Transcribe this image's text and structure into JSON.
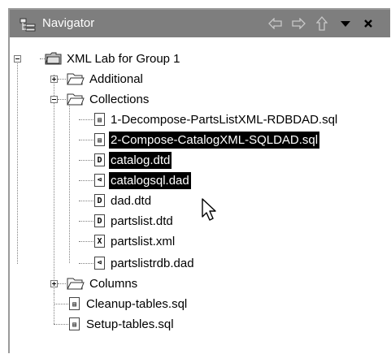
{
  "navigator": {
    "title": "Navigator",
    "icons": [
      "navigator-view-icon",
      "back-arrow-icon",
      "forward-arrow-icon",
      "up-arrow-icon",
      "view-menu-icon",
      "close-icon"
    ]
  },
  "tree": {
    "root": "XML Lab for Group 1",
    "additional": "Additional",
    "collections": "Collections",
    "file1": "1-Decompose-PartsListXML-RDBDAD.sql",
    "file2": "2-Compose-CatalogXML-SQLDAD.sql",
    "file3": "catalog.dtd",
    "file4": "catalogsql.dad",
    "file5": "dad.dtd",
    "file6": "partslist.dtd",
    "file7": "partslist.xml",
    "file8": "partslistrdb.dad",
    "columns": "Columns",
    "file9": "Cleanup-tables.sql",
    "file10": "Setup-tables.sql"
  },
  "colors": {
    "titlebar": "#7e7e7e",
    "selection": "#000000"
  }
}
